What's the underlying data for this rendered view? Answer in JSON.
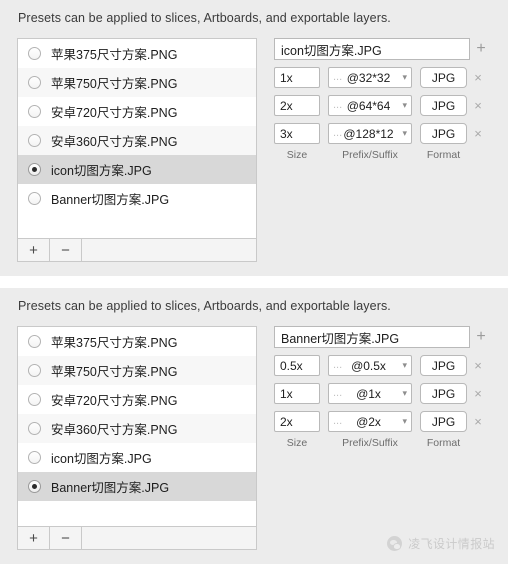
{
  "panels": [
    {
      "hint": "Presets can be applied to slices, Artboards, and exportable layers.",
      "presets": [
        {
          "label": "苹果375尺寸方案.PNG",
          "selected": false
        },
        {
          "label": "苹果750尺寸方案.PNG",
          "selected": false
        },
        {
          "label": "安卓720尺寸方案.PNG",
          "selected": false
        },
        {
          "label": "安卓360尺寸方案.PNG",
          "selected": false
        },
        {
          "label": "icon切图方案.JPG",
          "selected": true
        },
        {
          "label": "Banner切图方案.JPG",
          "selected": false
        }
      ],
      "footer": {
        "add_label": "+",
        "remove_label": "−"
      },
      "detail": {
        "name_value": "icon切图方案.JPG",
        "add_icon": "+",
        "exports": [
          {
            "size": "1x",
            "suffix_dots": "...",
            "suffix": "@32*32",
            "format": "JPG",
            "remove_icon": "×"
          },
          {
            "size": "2x",
            "suffix_dots": "...",
            "suffix": "@64*64",
            "format": "JPG",
            "remove_icon": "×"
          },
          {
            "size": "3x",
            "suffix_dots": "...",
            "suffix": "@128*12",
            "format": "JPG",
            "remove_icon": "×"
          }
        ],
        "columns": {
          "size": "Size",
          "suffix": "Prefix/Suffix",
          "format": "Format"
        }
      },
      "watermark": null
    },
    {
      "hint": "Presets can be applied to slices, Artboards, and exportable layers.",
      "presets": [
        {
          "label": "苹果375尺寸方案.PNG",
          "selected": false
        },
        {
          "label": "苹果750尺寸方案.PNG",
          "selected": false
        },
        {
          "label": "安卓720尺寸方案.PNG",
          "selected": false
        },
        {
          "label": "安卓360尺寸方案.PNG",
          "selected": false
        },
        {
          "label": "icon切图方案.JPG",
          "selected": false
        },
        {
          "label": "Banner切图方案.JPG",
          "selected": true
        }
      ],
      "footer": {
        "add_label": "+",
        "remove_label": "−"
      },
      "detail": {
        "name_value": "Banner切图方案.JPG",
        "add_icon": "+",
        "exports": [
          {
            "size": "0.5x",
            "suffix_dots": "...",
            "suffix": "@0.5x",
            "format": "JPG",
            "remove_icon": "×"
          },
          {
            "size": "1x",
            "suffix_dots": "...",
            "suffix": "@1x",
            "format": "JPG",
            "remove_icon": "×"
          },
          {
            "size": "2x",
            "suffix_dots": "...",
            "suffix": "@2x",
            "format": "JPG",
            "remove_icon": "×"
          }
        ],
        "columns": {
          "size": "Size",
          "suffix": "Prefix/Suffix",
          "format": "Format"
        }
      },
      "watermark": {
        "text": "凌飞设计情报站"
      }
    }
  ],
  "colors": {
    "panel_background": "#ececec",
    "list_background": "#ffffff",
    "row_alt": "#f7f7f7",
    "row_selected": "#d8d8d8",
    "border": "#c9c9c9",
    "text": "#1d1d1d",
    "muted_text": "#6d6d6d"
  }
}
